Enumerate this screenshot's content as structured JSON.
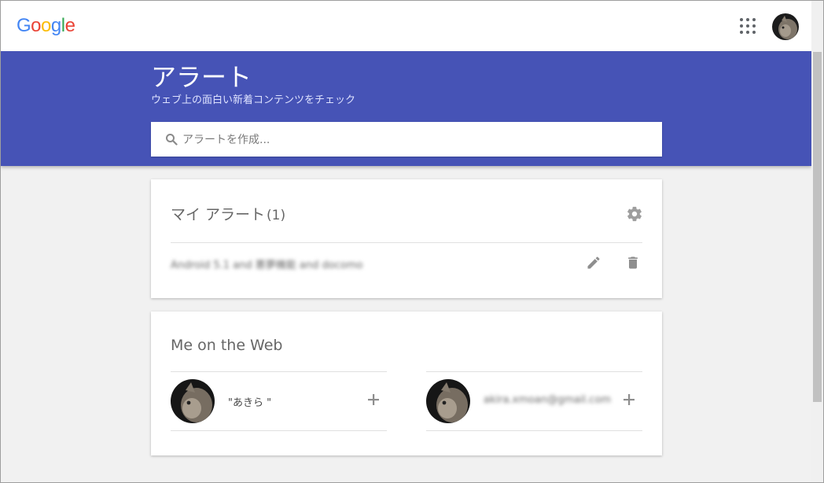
{
  "header": {
    "logo_text": "Google",
    "logo_colors": [
      "#4285F4",
      "#EA4335",
      "#FBBC05",
      "#4285F4",
      "#34A853",
      "#EA4335"
    ],
    "apps_icon": "apps-grid-icon",
    "avatar": "cat-avatar"
  },
  "hero": {
    "title": "アラート",
    "subtitle": "ウェブ上の面白い新着コンテンツをチェック",
    "background": "#4653b6"
  },
  "search": {
    "placeholder": "アラートを作成...",
    "value": ""
  },
  "my_alerts": {
    "title": "マイ アラート",
    "count": "(1)",
    "items": [
      {
        "query": "Android 5.1 and 悪夢機能 and docomo"
      }
    ]
  },
  "me_on_web": {
    "title": "Me on the Web",
    "items": [
      {
        "label": "\"あきら \""
      },
      {
        "label": "akira.xmoan@gmail.com"
      }
    ]
  }
}
